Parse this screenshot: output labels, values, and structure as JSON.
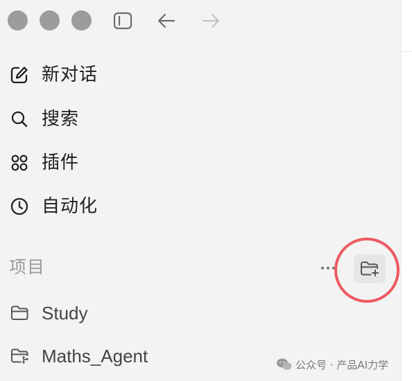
{
  "window": {
    "traffic_lights": [
      "close",
      "minimize",
      "zoom"
    ],
    "traffic_light_color": "#9c9c9c"
  },
  "toolbar": {
    "icons": [
      "sidebar-toggle-icon",
      "arrow-left-icon",
      "arrow-right-icon"
    ]
  },
  "nav": {
    "items": [
      {
        "label": "新对话",
        "icon": "edit-icon"
      },
      {
        "label": "搜索",
        "icon": "search-icon"
      },
      {
        "label": "插件",
        "icon": "plugins-icon"
      },
      {
        "label": "自动化",
        "icon": "clock-icon"
      }
    ]
  },
  "projects": {
    "header": "项目",
    "actions": [
      "more-icon",
      "new-folder-icon"
    ],
    "highlight_color": "#ee5a5f",
    "items": [
      {
        "label": "Study",
        "icon": "folder-icon"
      },
      {
        "label": "Maths_Agent",
        "icon": "folder-branch-icon"
      }
    ]
  },
  "watermark": {
    "text": "公众号 · 产品AI力学"
  }
}
